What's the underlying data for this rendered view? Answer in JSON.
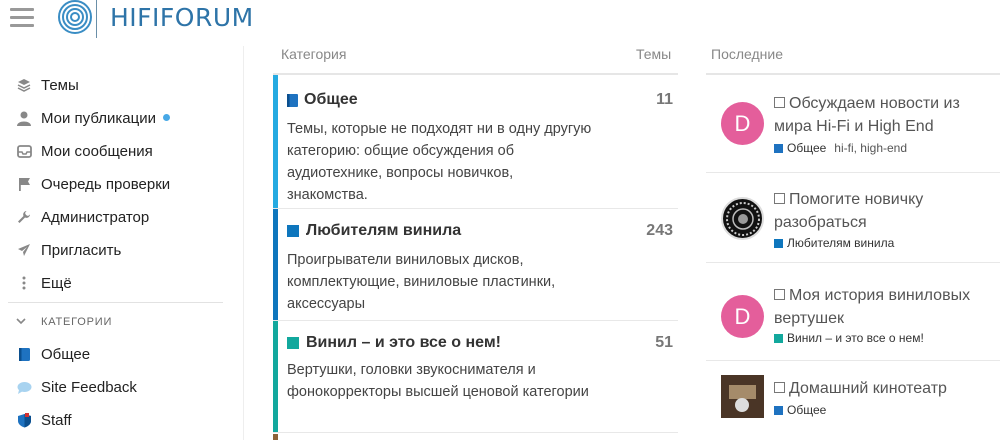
{
  "header": {
    "logo_text": "HIFIFORUM"
  },
  "sidebar": {
    "items": [
      {
        "label": "Темы",
        "icon": "layers-icon"
      },
      {
        "label": "Мои публикации",
        "icon": "user-icon",
        "has_dot": true
      },
      {
        "label": "Мои сообщения",
        "icon": "inbox-icon"
      },
      {
        "label": "Очередь проверки",
        "icon": "flag-icon"
      },
      {
        "label": "Администратор",
        "icon": "wrench-icon"
      },
      {
        "label": "Пригласить",
        "icon": "send-icon"
      },
      {
        "label": "Ещё",
        "icon": "more-vertical-icon"
      }
    ],
    "section_label": "КАТЕГОРИИ",
    "categories": [
      {
        "label": "Общее",
        "icon": "book-icon"
      },
      {
        "label": "Site Feedback",
        "icon": "comment-icon"
      },
      {
        "label": "Staff",
        "icon": "shield-icon"
      }
    ]
  },
  "columns": {
    "category": "Категория",
    "topics": "Темы",
    "latest": "Последние"
  },
  "categories": [
    {
      "name": "Общее",
      "count": "11",
      "color": "#25aae1",
      "description": "Темы, которые не подходят ни в одну другую категорию: общие обсуждения об аудиотехнике, вопросы новичков, знакомства."
    },
    {
      "name": "Любителям винила",
      "count": "243",
      "color": "#0e76bd",
      "description": "Проигрыватели виниловых дисков, комплектующие, виниловые пластинки, аксессуары"
    },
    {
      "name": "Винил – и это все о нем!",
      "count": "51",
      "color": "#12a89d",
      "description": "Вертушки, головки звукоснимателя и фонокорректоры высшей ценовой категории"
    }
  ],
  "latest": [
    {
      "title": "Обсуждаем новости из мира Hi-Fi и High End",
      "category": "Общее",
      "tags": "hi-fi, high-end",
      "avatar_letter": "D"
    },
    {
      "title": "Помогите новичку разобраться",
      "category": "Любителям винила",
      "tags": "",
      "avatar_letter": ""
    },
    {
      "title": "Моя история виниловых вертушек",
      "category": "Винил – и это все о нем!",
      "tags": "",
      "avatar_letter": "D"
    },
    {
      "title": "Домашний кинотеатр",
      "category": "Общее",
      "tags": "",
      "avatar_letter": ""
    }
  ],
  "colors": {
    "accent": "#2e74a8",
    "avatar_pink": "#e45e9b",
    "unread_dot": "#47a8e6"
  }
}
